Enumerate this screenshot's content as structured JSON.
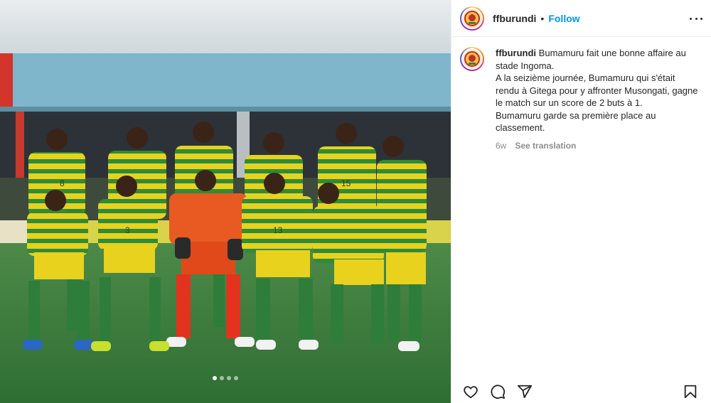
{
  "post": {
    "username": "ffburundi",
    "separator": "•",
    "follow_label": "Follow",
    "caption_lines": [
      "Bumamuru fait une bonne affaire au",
      "stade Ingoma.",
      "A la seizième journée, Bumamuru qui s'était",
      "rendu à Gitega pour y affronter Musongati, gagne",
      "le match sur un score de 2 buts à 1.",
      "Bumamuru garde sa première place au",
      "classement."
    ],
    "age": "6w",
    "translate_label": "See translation"
  },
  "carousel": {
    "count": 4,
    "active": 0
  },
  "photo": {
    "jersey_numbers": [
      "8",
      "15",
      "3",
      "13"
    ]
  },
  "colors": {
    "link": "#0095f6",
    "kit_yellow": "#e8d21d",
    "kit_green": "#2e8b3a",
    "keeper_orange": "#e85a22",
    "pitch": "#3f7f3f"
  },
  "icons": [
    "more-options-icon",
    "heart-icon",
    "comment-icon",
    "share-icon",
    "bookmark-icon"
  ]
}
